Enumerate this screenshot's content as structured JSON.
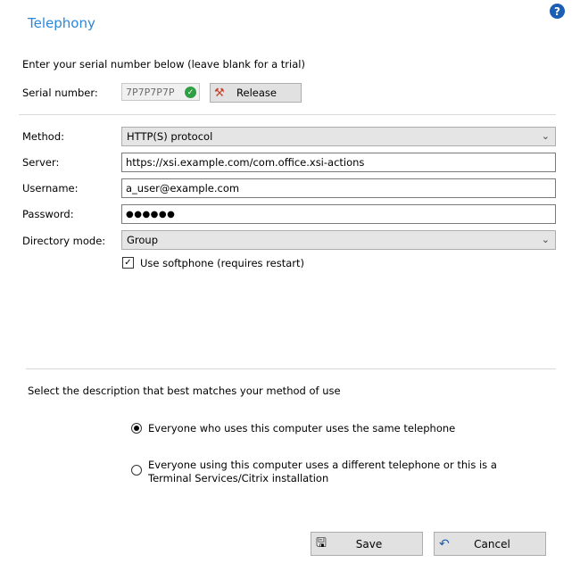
{
  "header": {
    "title": "Telephony",
    "help_icon": "?"
  },
  "serial": {
    "intro": "Enter your serial number below (leave blank for a trial)",
    "label": "Serial number:",
    "value": "7P7P7P7P",
    "release_label": "Release"
  },
  "form": {
    "method_label": "Method:",
    "method_value": "HTTP(S) protocol",
    "server_label": "Server:",
    "server_value": "https://xsi.example.com/com.office.xsi-actions",
    "username_label": "Username:",
    "username_value": "a_user@example.com",
    "password_label": "Password:",
    "password_value": "●●●●●●",
    "directory_label": "Directory mode:",
    "directory_value": "Group",
    "softphone_label": "Use softphone (requires restart)",
    "softphone_checked": true
  },
  "usage": {
    "prompt": "Select the description that best matches your method of use",
    "options": [
      {
        "label": "Everyone who uses this computer uses the same telephone",
        "selected": true
      },
      {
        "label": "Everyone using this computer uses a different telephone or this is a Terminal Services/Citrix installation",
        "selected": false
      }
    ]
  },
  "footer": {
    "save_label": "Save",
    "cancel_label": "Cancel"
  }
}
